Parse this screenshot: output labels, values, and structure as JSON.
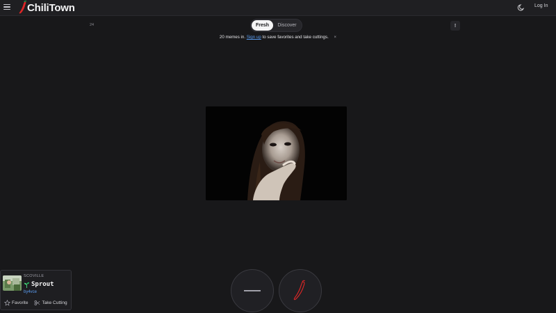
{
  "header": {
    "logo_text": "ChiliTown",
    "login_label": "Log In"
  },
  "feed": {
    "counter": "24",
    "tabs": [
      {
        "label": "Fresh",
        "active": true
      },
      {
        "label": "Discover",
        "active": false
      }
    ],
    "more_label": "!"
  },
  "notice": {
    "before": "20 memes in.",
    "link": "Sign up",
    "after": "to save favorites and take cuttings.",
    "close": "×"
  },
  "user_card": {
    "rank_label": "SCOVILLE",
    "rank_name": "Sprout",
    "username": "by4vce",
    "favorite_label": "Favorite",
    "cutting_label": "Take Cutting"
  },
  "colors": {
    "background": "#18181a",
    "accent_red": "#dc2626",
    "link_blue": "#5b9cf0"
  },
  "icons": [
    "menu-icon",
    "chili-logo-icon",
    "moon-icon",
    "pass-icon",
    "chili-icon",
    "sprout-icon",
    "star-icon",
    "scissors-icon"
  ]
}
